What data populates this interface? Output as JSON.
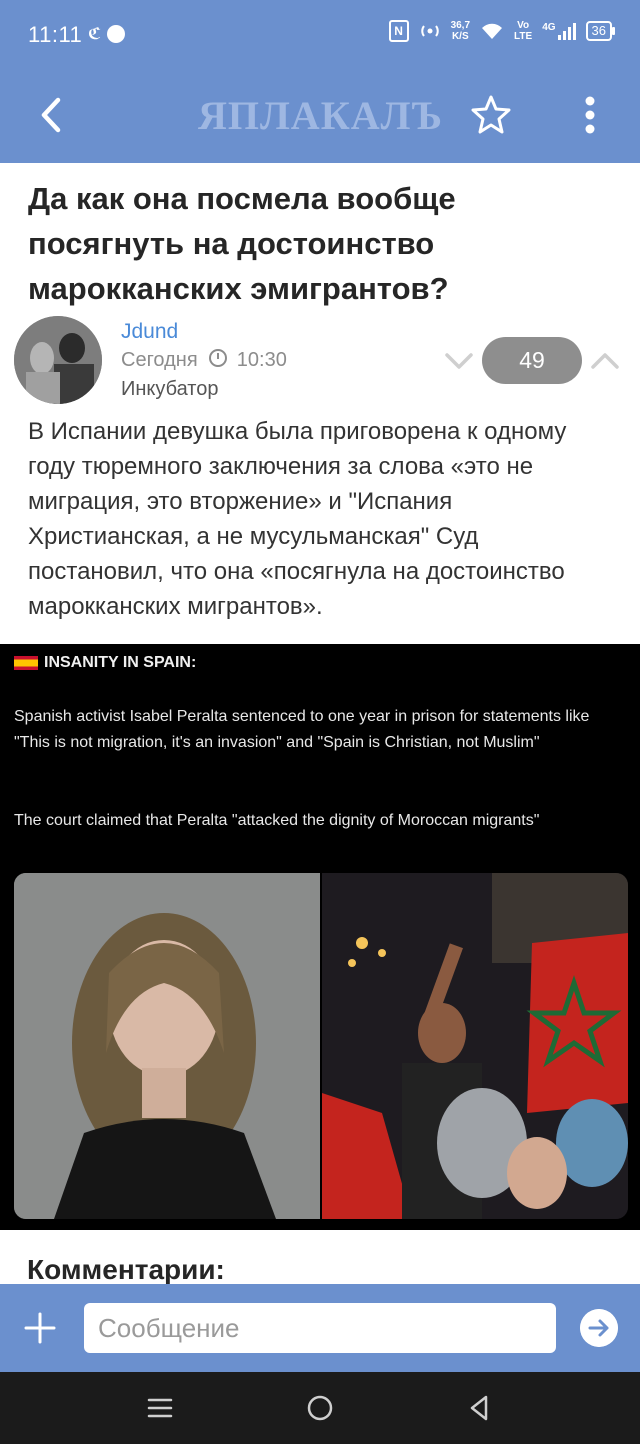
{
  "status_bar": {
    "time": "11:11",
    "network_speed_value": "36,7",
    "network_speed_unit": "K/S",
    "volte_top": "Vo",
    "volte_bottom": "LTE",
    "network_type": "4G",
    "battery": "36"
  },
  "header": {
    "logo_text": "ЯПЛАКАЛЪ",
    "icons": [
      "back-arrow-icon",
      "star-icon",
      "more-vertical-icon"
    ]
  },
  "post": {
    "title": "Да как она посмела вообще посягнуть на достоинство марокканских эмигрантов?",
    "author": "Jdund",
    "date": "Сегодня",
    "time": "10:30",
    "section": "Инкубатор",
    "rating": "49",
    "body": "В Испании девушка была приговорена к одному году тюремного заключения за слова «это не миграция, это вторжение» и \"Испания Христианская, а не мусульманская\" Суд постановил, что она «посягнула на достоинство марокканских мигрантов».",
    "image": {
      "headline": "INSANITY IN SPAIN:",
      "paragraph1": "Spanish activist Isabel Peralta sentenced to one year in prison for statements like \"This is not migration, it's an invasion\" and \"Spain is Christian, not Muslim\"",
      "paragraph2": "The court claimed that Peralta \"attacked the dignity of Moroccan migrants\""
    }
  },
  "comments": {
    "heading": "Комментарии:"
  },
  "composer": {
    "placeholder": "Сообщение"
  },
  "colors": {
    "brand_blue": "#6b90ce",
    "link_blue": "#4a8ad8",
    "rating_pill": "#8e8e8e",
    "nav_bar": "#1b1b1b"
  }
}
